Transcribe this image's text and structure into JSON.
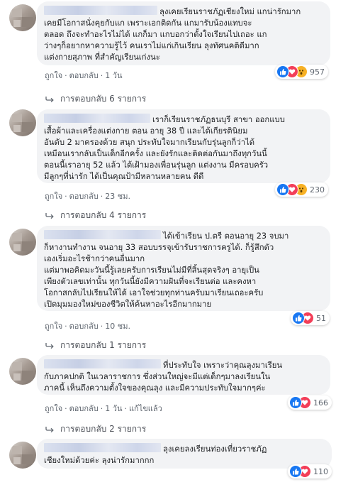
{
  "comments": [
    {
      "text_lines": [
        "ลุงเคยเรียนราชภัฏเชียงใหม่ แกน่ารักมาก",
        "เคยมีโอกาสนั่งคุยกับแก เพราะเอกติดกัน แกมารับน้องแทบจะ",
        "ตลอด ถึงจะทำอะไรไม่ได้ แกก็มา แกบอกว่าตั้งใจเรียนไปเถอะ แก",
        "ว่างๆก็อยากหาความรู้ไว้ คนเราไม่แก่เกินเรียน ลุงทัศนคติดีมาก",
        "แต่งกายสุภาพ ที่สำคัญเรียนเก่งนะ"
      ],
      "actions": {
        "like": "ถูกใจ",
        "reply": "ตอบกลับ",
        "time": "1 วัน",
        "edited": ""
      },
      "reactions": {
        "icons": [
          "like",
          "love",
          "wow"
        ],
        "count": "957"
      },
      "replies": "การตอบกลับ 6 รายการ"
    },
    {
      "text_lines": [
        "เราก็เรียนราชภัฏธนบุรี สาขา ออกแบบ",
        "เสื้อผ้าและเครื่องแต่งกาย ตอน อายุ 38 ปี และได้เกียรตินิยม",
        "อันดับ 2 มาครองด้วย สนุก ประทับใจมากเรียนกับรุ่นลูกก็ว่าได้",
        "เหมือนเรากลับเป็นเด็กอีกครั้ง และยังรักและติดต่อกันมาถึงทุกวันนี้",
        "ตอนนี้เราอายุ 52 แล้ว ได้เฝ้ามองเพื่อนรุ่นลูก แต่งงาน มีครอบครัว",
        "มีลูกๆที่น่ารัก ได้เป็นคุณป้ามีหลานหลายคน ดีดี"
      ],
      "actions": {
        "like": "ถูกใจ",
        "reply": "ตอบกลับ",
        "time": "23 ชม.",
        "edited": ""
      },
      "reactions": {
        "icons": [
          "like",
          "love",
          "wow"
        ],
        "count": "230"
      },
      "replies": "การตอบกลับ 4 รายการ"
    },
    {
      "text_lines": [
        "ได้เข้าเรียน ป.ตรี ตอนอายุ 23 จบมา",
        "ก็หางานทำงาน จนอายุ 33 สอบบรรจุเข้ารับราชการครูได้. ก็รู้สึกตัว",
        "เองเริ่มอะไรช้ากว่าคนอื่นมาก",
        "แต่มาพอคิดมะวันนี้รู้เลยครับการเรียนไม่มีที่สิ้นสุดจริงๆ อายุเป็น",
        "เพียงตัวเลขเท่านั้น ทุกวันนี้ยังมีความฝันที่จะเรียนต่อ และคงหา",
        "โอกาสกลับไปเรียนให้ได้ เอาใจช่วยทุกท่านครับมาเรียนเถอะครับ",
        "เปิดมุมมองใหม่ของชีวิตให้ค้นหาอะไรอีกมากมาย"
      ],
      "actions": {
        "like": "ถูกใจ",
        "reply": "ตอบกลับ",
        "time": "10 ชม.",
        "edited": ""
      },
      "reactions": {
        "icons": [
          "like",
          "love"
        ],
        "count": "51"
      },
      "replies": "การตอบกลับ 1 รายการ"
    },
    {
      "text_lines": [
        "ที่ประทับใจ เพราะว่าคุณลุงมาเรียน",
        "กับภาคปกติ ในเวลาราชการ ซึ่งส่วนใหญ่จะมีแต่เด็กๆมาลงเรียนใน",
        "ภาคนี้ เห็นถึงความตั้งใจของคุณลุง และมีความประทับใจมากๆค่ะ"
      ],
      "actions": {
        "like": "ถูกใจ",
        "reply": "ตอบกลับ",
        "time": "1 วัน",
        "edited": "แก้ไขแล้ว"
      },
      "reactions": {
        "icons": [
          "like",
          "love"
        ],
        "count": "166"
      },
      "replies": "การตอบกลับ 2 รายการ"
    },
    {
      "text_lines": [
        "ลุงเคยลงเรียนท่องเที่ยวราชภัฏ",
        "เชียงใหม่ด้วยค่ะ ลุงน่ารักมากกก"
      ],
      "actions": {
        "like": "",
        "reply": "",
        "time": "",
        "edited": ""
      },
      "reactions": {
        "icons": [
          "like",
          "love"
        ],
        "count": "110"
      },
      "replies": ""
    }
  ],
  "colors": {
    "like": "#1877f2",
    "love": "#f33e58",
    "wow": "#f7b125",
    "bubble": "#f2f3f5",
    "meta": "#606770"
  }
}
